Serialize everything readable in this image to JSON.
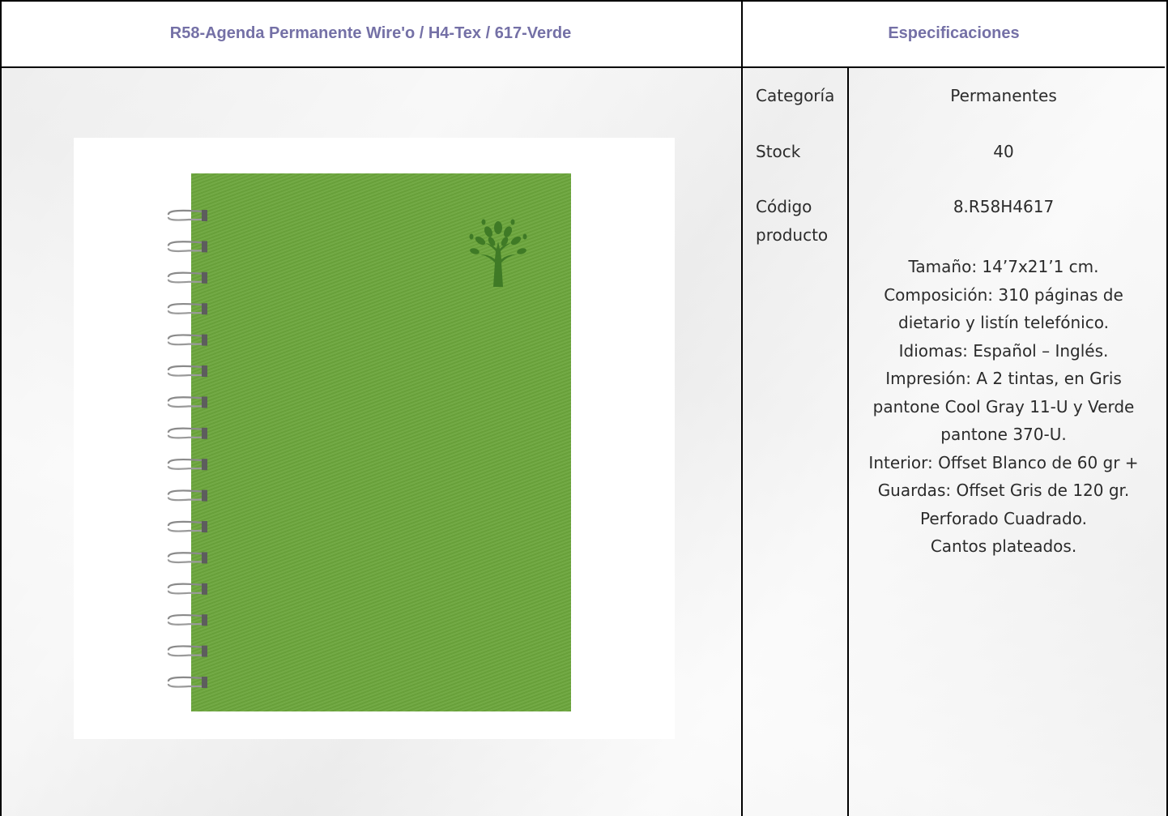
{
  "header": {
    "product_title": "R58-Agenda Permanente Wire'o / H4-Tex / 617-Verde",
    "specs_title": "Especificaciones"
  },
  "product": {
    "cover_color": "#6ca63c",
    "image_alt": "R58-Agenda Permanente Wire'o / H4-Tex / 617-Verde"
  },
  "specs": {
    "category_label": "Categoría",
    "category_value": "Permanentes",
    "stock_label": "Stock",
    "stock_value": "40",
    "code_label_line1": "Código",
    "code_label_line2": "producto",
    "code_value": "8.R58H4617",
    "description_lines": [
      "Tamaño: 14’7x21’1 cm.",
      "Composición: 310 páginas de",
      "dietario y listín telefónico.",
      "Idiomas: Español – Inglés.",
      "Impresión: A 2 tintas, en Gris",
      "pantone Cool Gray 11-U y Verde",
      "pantone 370-U.",
      "Interior: Offset Blanco de 60 gr +",
      "Guardas: Offset Gris de 120 gr.",
      "Perforado Cuadrado.",
      "Cantos plateados."
    ]
  }
}
